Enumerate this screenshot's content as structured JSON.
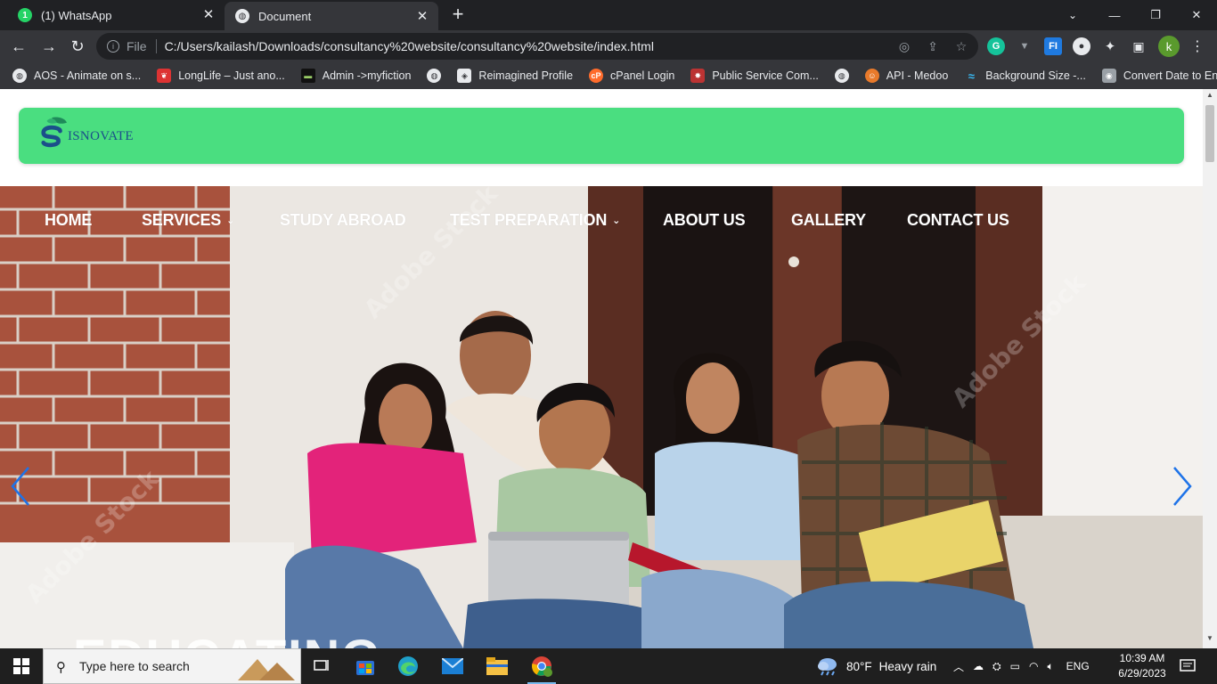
{
  "browser": {
    "tabs": [
      {
        "title": "(1) WhatsApp",
        "badge": "1",
        "active": false
      },
      {
        "title": "Document",
        "active": true
      }
    ],
    "address": {
      "scheme_label": "File",
      "url": "C:/Users/kailash/Downloads/consultancy%20website/consultancy%20website/index.html"
    },
    "profile_initial": "k",
    "bookmarks": [
      {
        "label": "AOS - Animate on s..."
      },
      {
        "label": "LongLife – Just ano..."
      },
      {
        "label": "Admin ->myfiction"
      },
      {
        "label": ""
      },
      {
        "label": "Reimagined Profile"
      },
      {
        "label": "cPanel Login"
      },
      {
        "label": "Public Service Com..."
      },
      {
        "label": ""
      },
      {
        "label": "API - Medoo"
      },
      {
        "label": "Background Size -..."
      },
      {
        "label": "Convert Date to En..."
      }
    ]
  },
  "site": {
    "logo_text": "ISNOVATE",
    "nav": [
      {
        "label": "HOME",
        "dropdown": false
      },
      {
        "label": "SERVICES",
        "dropdown": true
      },
      {
        "label": "STUDY ABROAD",
        "dropdown": false
      },
      {
        "label": "TEST PREPARATION",
        "dropdown": true
      },
      {
        "label": "ABOUT US",
        "dropdown": false
      },
      {
        "label": "GALLERY",
        "dropdown": false
      },
      {
        "label": "CONTACT US",
        "dropdown": false
      }
    ],
    "hero_heading": "EDUCATING",
    "brand_color": "#4ade80",
    "logo_color": "#1b4f8a",
    "arrow_color": "#1e73e8"
  },
  "taskbar": {
    "search_placeholder": "Type here to search",
    "weather_temp": "80°F",
    "weather_text": "Heavy rain",
    "language": "ENG",
    "time": "10:39 AM",
    "date": "6/29/2023"
  }
}
